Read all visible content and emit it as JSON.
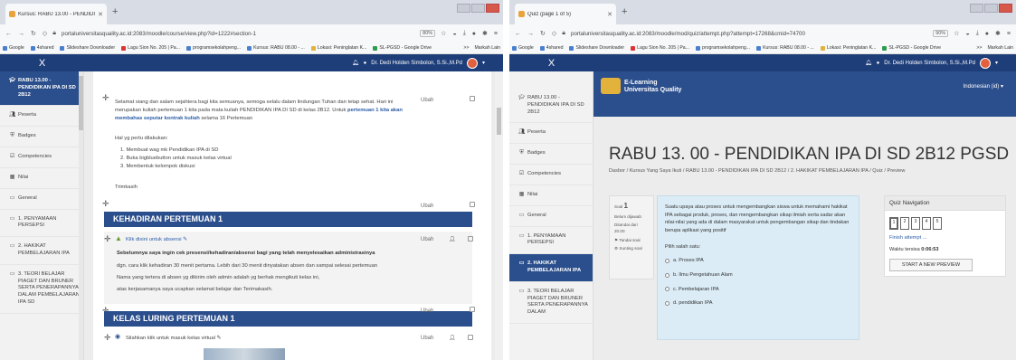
{
  "left_window": {
    "tab_title": "Kursus: RABU 13.00 - PENDIDI",
    "url": "portaluniversitasquality.ac.id:2083/moodle/course/view.php?id=1222#section-1",
    "zoom": "80%",
    "bookmarks": [
      "Google",
      "4shared",
      "Slideshare Downloader",
      "Lagu Sion No. 205 | Pa...",
      "programsekolahpeng...",
      "Kursus: RABU 08.00 - ...",
      "Lokasi: Peninglatan K...",
      "SL-PGSD - Google Drive"
    ],
    "bookmarks_right": [
      ">>",
      "Markah Lain"
    ],
    "close_label": "X",
    "user_name": "Dr. Dedi Holden Simbolon, S.Si.,M.Pd",
    "sidebar": [
      {
        "icon": "cap",
        "label": "RABU 13.00 - PENDIDIKAN IPA DI SD 2B12",
        "active": true
      },
      {
        "icon": "users",
        "label": "Peserta"
      },
      {
        "icon": "badge",
        "label": "Badges"
      },
      {
        "icon": "check",
        "label": "Competencies"
      },
      {
        "icon": "grid",
        "label": "Nilai"
      },
      {
        "icon": "folder",
        "label": "General"
      },
      {
        "icon": "folder",
        "label": "1. PENYAMAAN PERSEPSI"
      },
      {
        "icon": "folder",
        "label": "2. HAKIKAT PEMBELAJARAN IPA"
      },
      {
        "icon": "folder",
        "label": "3. TEORI BELAJAR PIAGET DAN BRUNER SERTA PENERAPANNYA DALAM PEMBELAJARAN IPA SD"
      }
    ],
    "intro_p1": "Selamat siang dan salam sejahtera bagi kita semuanya, semoga selalu dalam lindungan Tuhan dan tetap sehat. Hari ini merupakan kuliah pertemuan 1 kita pada mata kuliah PENDIDIKAN IPA DI SD di kelas 2B12. Untuk",
    "intro_bold": "pertemuan 1 kita akan membahas seputar kontrak kuliah",
    "intro_tail": "selama 16 Pertemuan",
    "todo_title": "Hal yg perlu dilakukan:",
    "todo_items": [
      "1. Membuat wag mk Pendidikan IPA di SD",
      "2. Buka bigbluebutton untuk masuk kelas virtual",
      "3. Membentuk kelompok diskusi"
    ],
    "thanks": "Trimkasih",
    "edit_label": "Ubah",
    "section1_title": "KEHADIRAN PERTEMUAN 1",
    "attend_link": "Klik disini untuk absensi",
    "attend_bold": "Sebelumnya saya ingin cek presensi/kehadiran/absensi bagi yang telah menyelesaikan administrasinya",
    "attend_lines": [
      "dgn. cara klik kehadiran 30 menit pertama. Lebih dari 30 menit dinyatakan absen dan sampai selesai pertemuan",
      "Nama yang tertera di absen yg dikirim oleh admin adalah yg berhak mengikuti kelas ini,",
      "atas kerjasamanya saya ucapkan selamat belajar dan Terimakasih."
    ],
    "section2_title": "KELAS LURING PERTEMUAN 1",
    "virtual_link": "Silahkan klik untuk masuk kelas virtual"
  },
  "right_window": {
    "tab_title": "Quiz (page 1 of 5)",
    "url": "portaluniversitasquality.ac.id:2083/moodle/mod/quiz/attempt.php?attempt=17268&cmid=74700",
    "zoom": "90%",
    "bookmarks": [
      "Google",
      "4shared",
      "Slideshare Downloader",
      "Lagu Sion No. 205 | Pa...",
      "programsekolahpeng...",
      "Kursus: RABU 08.00 - ...",
      "Lokasi: Peninglatan K...",
      "SL-PGSD - Google Drive"
    ],
    "bookmarks_right": [
      ">>",
      "Markah Lain"
    ],
    "close_label": "X",
    "user_name": "Dr. Dedi Holden Simbolon, S.Si.,M.Pd",
    "logo_line1": "E-Learning",
    "logo_line2": "Universitas Quality",
    "language": "Indonesian (id)",
    "sidebar": [
      {
        "icon": "cap",
        "label": "RABU 13.00 - PENDIDIKAN IPA DI SD 2B12"
      },
      {
        "icon": "users",
        "label": "Peserta"
      },
      {
        "icon": "badge",
        "label": "Badges"
      },
      {
        "icon": "check",
        "label": "Competencies"
      },
      {
        "icon": "grid",
        "label": "Nilai"
      },
      {
        "icon": "folder",
        "label": "General"
      },
      {
        "icon": "folder",
        "label": "1. PENYAMAAN PERSEPSI"
      },
      {
        "icon": "folder",
        "label": "2. HAKIKAT PEMBELAJARAN IPA",
        "active": true
      },
      {
        "icon": "folder",
        "label": "3. TEORI BELAJAR PIAGET DAN BRUNER SERTA PENERAPANNYA DALAM"
      }
    ],
    "course_title": "RABU 13. 00 - PENDIDIKAN IPA DI SD 2B12 PGSD",
    "breadcrumb": "Dasbor / Kursus Yang Saya Ikuti / RABU 13.00 - PENDIDIKAN IPA DI SD 2B12 / 2. HAKIKAT PEMBELAJARAN IPA / Quiz / Preview",
    "info": {
      "soal": "Soal",
      "num": "1",
      "status": "Belum dijawab",
      "points": "Ditandai dari 20.00",
      "flag": "Tandai soal",
      "edit": "Sunting soal"
    },
    "question": "Suatu upaya atau proses untuk mengembangkan siswa untuk memahami hakikat IPA sebagai produk, proses, dan mengembangkan sikap ilmiah serta sadar akan nilai-nilai yang ada di dalam masyarakat untuk pengembangan sikap dan tindakan berupa aplikasi yang positif",
    "choose": "Pilih salah satu:",
    "options": [
      "a. Proses IPA",
      "b. Ilmu Pengetahuan Alam",
      "c. Pembelajaran IPA",
      "d. pendidikan IPA"
    ],
    "qnav_title": "Quiz Navigation",
    "qnav_pages": [
      "1",
      "2",
      "3",
      "4",
      "5"
    ],
    "finish": "Finish attempt ...",
    "timer_label": "Waktu tersisa",
    "timer_value": "0:06:53",
    "preview_btn": "START A NEW PREVIEW"
  }
}
